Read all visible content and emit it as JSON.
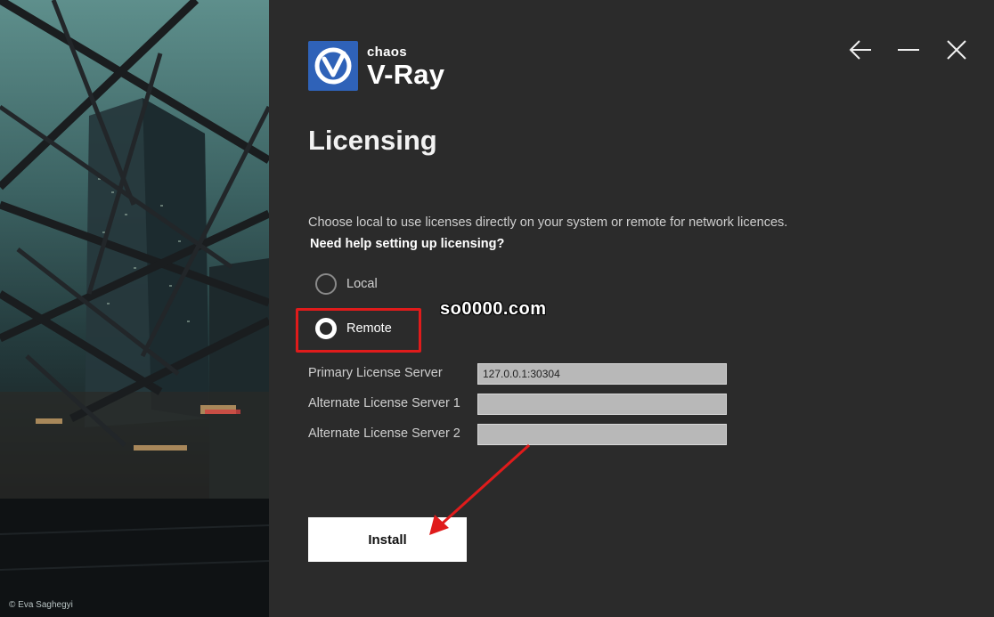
{
  "art": {
    "credit": "© Eva Saghegyi"
  },
  "brand": {
    "company": "chaos",
    "product": "V-Ray",
    "logo_color": "#2f62b8"
  },
  "window": {
    "back_icon": "arrow-left-icon",
    "minimize_icon": "minimize-icon",
    "close_icon": "close-icon"
  },
  "page": {
    "title": "Licensing",
    "description": "Choose local to use licenses directly on your system or remote for network licences.",
    "help_link": "Need help setting up licensing?"
  },
  "license_mode": {
    "options": [
      {
        "label": "Local",
        "selected": false
      },
      {
        "label": "Remote",
        "selected": true
      }
    ]
  },
  "servers": {
    "primary_label": "Primary License Server",
    "primary_value": "127.0.0.1:30304",
    "alt1_label": "Alternate License Server 1",
    "alt1_value": "",
    "alt2_label": "Alternate License Server 2",
    "alt2_value": ""
  },
  "actions": {
    "install_label": "Install"
  },
  "annotation": {
    "watermark": "so0000.com",
    "highlight_color": "#e01b1b"
  }
}
